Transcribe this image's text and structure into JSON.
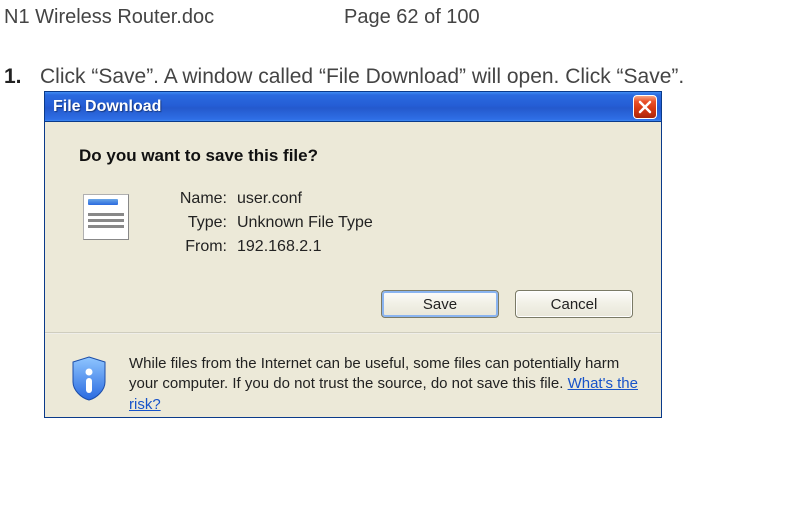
{
  "doc": {
    "title": "N1 Wireless Router.doc",
    "page_label": "Page 62 of 100"
  },
  "instruction": {
    "number": "1.",
    "text": "Click “Save”. A window called “File Download” will open. Click “Save”."
  },
  "dialog": {
    "title": "File Download",
    "prompt": "Do you want to save this file?",
    "props": {
      "name_label": "Name:",
      "name_value": "user.conf",
      "type_label": "Type:",
      "type_value": "Unknown File Type",
      "from_label": "From:",
      "from_value": "192.168.2.1"
    },
    "buttons": {
      "save": "Save",
      "cancel": "Cancel"
    },
    "warning": {
      "text_prefix": "While files from the Internet can be useful, some files can potentially harm your computer. If you do not trust the source, do not save this file. ",
      "link_text": "What's the risk?"
    }
  }
}
